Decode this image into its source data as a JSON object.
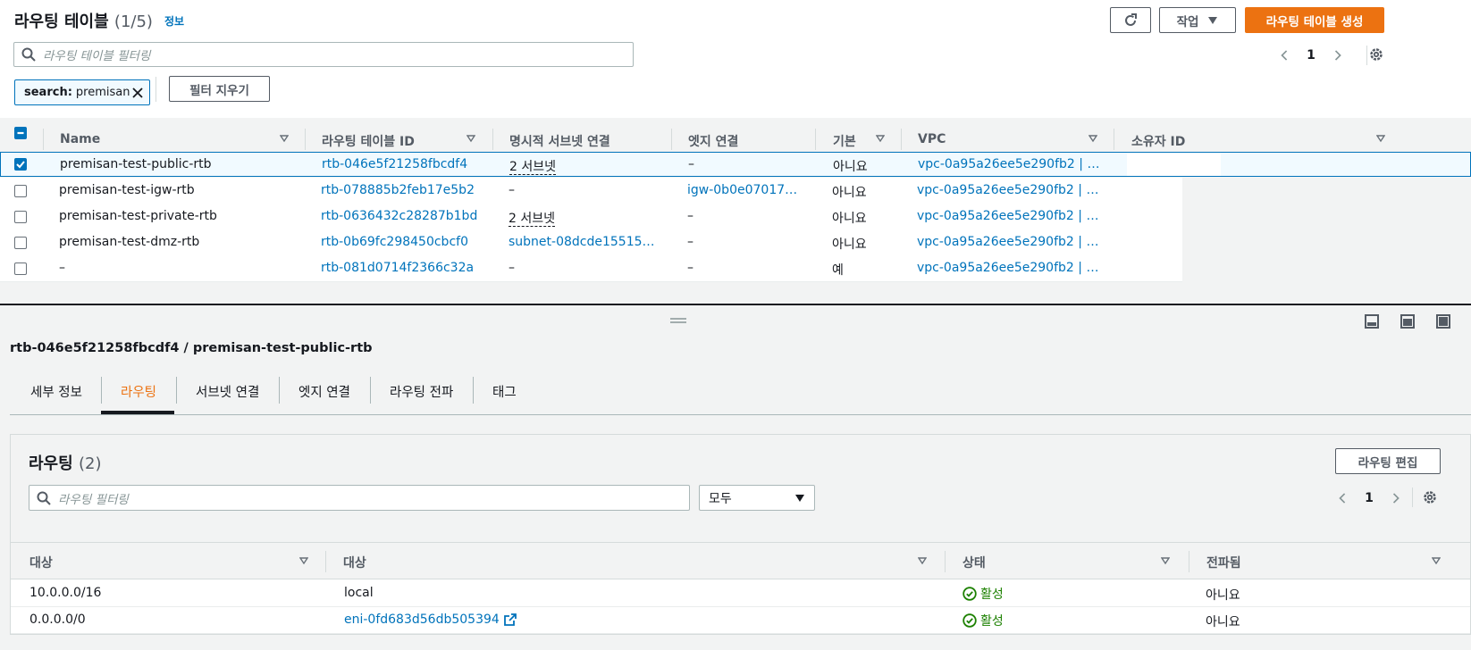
{
  "header": {
    "title": "라우팅 테이블",
    "count": "(1/5)",
    "info": "정보",
    "actions_label": "작업",
    "create_label": "라우팅 테이블 생성"
  },
  "search": {
    "placeholder": "라우팅 테이블 필터링",
    "chip_key": "search:",
    "chip_value": "premisan",
    "clear_filters": "필터 지우기"
  },
  "pagination": {
    "page": "1"
  },
  "table": {
    "columns": [
      "Name",
      "라우팅 테이블 ID",
      "명시적 서브넷 연결",
      "엣지 연결",
      "기본",
      "VPC",
      "소유자 ID"
    ],
    "rows": [
      {
        "name": "premisan-test-public-rtb",
        "id": "rtb-046e5f21258fbcdf4",
        "subnet": "2 서브넷",
        "edge": "–",
        "main": "아니요",
        "vpc": "vpc-0a95a26ee5e290fb2 | pre…",
        "checked": true
      },
      {
        "name": "premisan-test-igw-rtb",
        "id": "rtb-078885b2feb17e5b2",
        "subnet": "–",
        "edge": "igw-0b0e070175c…",
        "main": "아니요",
        "vpc": "vpc-0a95a26ee5e290fb2 | pre…",
        "checked": false
      },
      {
        "name": "premisan-test-private-rtb",
        "id": "rtb-0636432c28287b1bd",
        "subnet": "2 서브넷",
        "edge": "–",
        "main": "아니요",
        "vpc": "vpc-0a95a26ee5e290fb2 | pre…",
        "checked": false
      },
      {
        "name": "premisan-test-dmz-rtb",
        "id": "rtb-0b69fc298450cbcf0",
        "subnet": "subnet-08dcde1551506…",
        "edge": "–",
        "main": "아니요",
        "vpc": "vpc-0a95a26ee5e290fb2 | pre…",
        "checked": false
      },
      {
        "name": "–",
        "id": "rtb-081d0714f2366c32a",
        "subnet": "–",
        "edge": "–",
        "main": "예",
        "vpc": "vpc-0a95a26ee5e290fb2 | pre…",
        "checked": false
      }
    ]
  },
  "detail": {
    "title": "rtb-046e5f21258fbcdf4 / premisan-test-public-rtb",
    "tabs": [
      "세부 정보",
      "라우팅",
      "서브넷 연결",
      "엣지 연결",
      "라우팅 전파",
      "태그"
    ],
    "active_tab": "라우팅"
  },
  "routes": {
    "title": "라우팅",
    "count": "(2)",
    "edit_label": "라우팅 편집",
    "filter_placeholder": "라우팅 필터링",
    "select_value": "모두",
    "page": "1",
    "columns": [
      "대상",
      "대상",
      "상태",
      "전파됨"
    ],
    "rows": [
      {
        "destination": "10.0.0.0/16",
        "target": "local",
        "status": "활성",
        "propagated": "아니요",
        "target_link": false
      },
      {
        "destination": "0.0.0.0/0",
        "target": "eni-0fd683d56db505394",
        "status": "활성",
        "propagated": "아니요",
        "target_link": true
      }
    ]
  },
  "colors": {
    "accent": "#ec7211",
    "link": "#0073bb",
    "success": "#1d8102"
  }
}
